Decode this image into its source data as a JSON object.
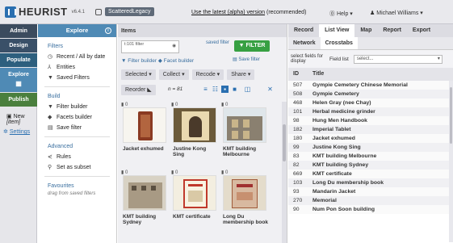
{
  "header": {
    "logo_text": "HEURIST",
    "version": "v6.4.1",
    "database": "ScatteredLegacy",
    "alpha_link": "Use the latest (alpha) version",
    "alpha_suffix": "(recommended)",
    "help": "Help",
    "user": "Michael Williams"
  },
  "leftnav": {
    "admin": "Admin",
    "design": "Design",
    "populate": "Populate",
    "explore": "Explore",
    "publish": "Publish",
    "new": "New",
    "new_item": "[item]",
    "settings": "Settings"
  },
  "explore_panel": {
    "title": "Explore",
    "filters_title": "Filters",
    "filters": [
      "Recent / All by date",
      "Entities",
      "Saved Filters"
    ],
    "build_title": "Build",
    "build": [
      "Filter builder",
      "Facets builder",
      "Save filter"
    ],
    "advanced_title": "Advanced",
    "advanced": [
      "Rules",
      "Set as subset"
    ],
    "favourites_title": "Favourites",
    "favourites_hint": "drag from saved filters"
  },
  "items": {
    "title": "Items",
    "filter_placeholder": "t:101 filter",
    "saved_filter": "saved filter",
    "filter_button": "FILTER",
    "filter_builder": "Filter builder",
    "facet_builder": "Facet builder",
    "save_filter": "Save filter",
    "menus": [
      "Selected",
      "Collect",
      "Recode",
      "Share"
    ],
    "reorder": "Reorder",
    "count": "n = 81",
    "thumbnails": [
      {
        "caption": "Jacket exhumed",
        "badge": "0"
      },
      {
        "caption": "Justine Kong Sing",
        "badge": "0"
      },
      {
        "caption": "KMT building Melbourne",
        "badge": "0"
      },
      {
        "caption": "KMT building Sydney",
        "badge": "0"
      },
      {
        "caption": "KMT certificate",
        "badge": "0"
      },
      {
        "caption": "Long Du membership book",
        "badge": "0"
      }
    ]
  },
  "right_panel": {
    "tabs": [
      "Record",
      "List View",
      "Map",
      "Report",
      "Export"
    ],
    "active_tab": "List View",
    "subtabs": [
      "Network",
      "Crosstabs"
    ],
    "select_fields": "select fields for display",
    "field_list_label": "Field list",
    "field_list_value": "select...",
    "col_id": "ID",
    "col_title": "Title",
    "rows": [
      {
        "id": "507",
        "title": "Gympie Cemetery Chinese Memorial"
      },
      {
        "id": "508",
        "title": "Gympie Cemetery"
      },
      {
        "id": "468",
        "title": "Helen Gray (nee Chay)"
      },
      {
        "id": "101",
        "title": "Herbal medicine grinder"
      },
      {
        "id": "98",
        "title": "Hung Men Handbook"
      },
      {
        "id": "182",
        "title": "Imperial Tablet"
      },
      {
        "id": "180",
        "title": "Jacket exhumed"
      },
      {
        "id": "99",
        "title": "Justine Kong Sing"
      },
      {
        "id": "83",
        "title": "KMT building Melbourne"
      },
      {
        "id": "82",
        "title": "KMT building Sydney"
      },
      {
        "id": "669",
        "title": "KMT certificate"
      },
      {
        "id": "103",
        "title": "Long Du membership book"
      },
      {
        "id": "93",
        "title": "Mandarin Jacket"
      },
      {
        "id": "270",
        "title": "Memorial"
      },
      {
        "id": "90",
        "title": "Num Pon Soon building"
      }
    ]
  }
}
